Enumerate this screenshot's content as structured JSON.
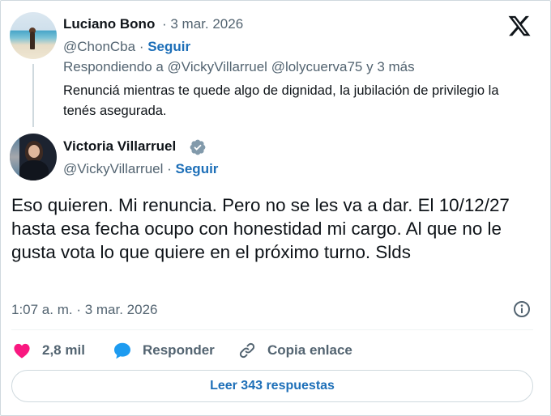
{
  "reply": {
    "author_name": "Luciano Bono",
    "date": "· 3 mar. 2026",
    "handle": "@ChonCba",
    "handle_sep": " · ",
    "follow_label": "Seguir",
    "replying_prefix": "Respondiendo a ",
    "replying_mention_1": "@VickyVillarruel",
    "replying_mention_2": "@lolycuerva75",
    "replying_suffix": " y 3 más",
    "text": "Renunciá mientras te quede algo de dignidad, la jubilación de privilegio la tenés asegurada."
  },
  "tweet": {
    "author_name": "Victoria Villarruel",
    "handle": "@VickyVillarruel",
    "handle_sep": " · ",
    "follow_label": "Seguir",
    "text": "Eso quieren. Mi renuncia. Pero no se les va a dar. El 10/12/27 hasta esa fecha ocupo con honestidad mi cargo. Al que no le gusta vota lo que quiere en el próximo turno. Slds",
    "timestamp": "1:07 a. m. · 3 mar. 2026"
  },
  "actions": {
    "likes": "2,8 mil",
    "reply_label": "Responder",
    "copy_link_label": "Copia enlace"
  },
  "read_replies_label": "Leer 343 respuestas",
  "icons": {
    "logo": "x-logo-icon",
    "verified": "verified-badge-icon",
    "info": "info-icon",
    "like": "heart-icon",
    "reply": "speech-bubble-icon",
    "link": "link-icon"
  },
  "colors": {
    "accent": "#1d6fb8",
    "like": "#f91880",
    "reply_icon": "#1d9bf0",
    "verified_badge": "#829aab",
    "muted_text": "#536471"
  }
}
